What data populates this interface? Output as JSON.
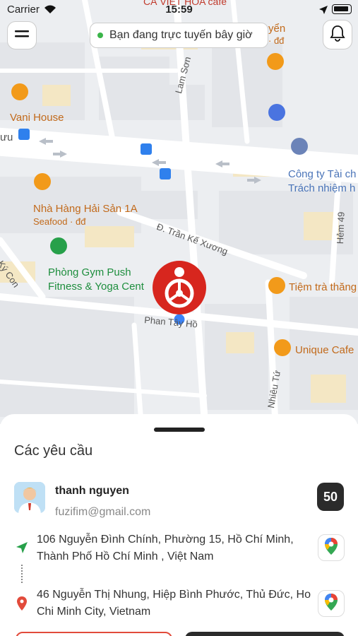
{
  "status_bar": {
    "carrier": "Carrier",
    "time": "15:59"
  },
  "header": {
    "online_status": "Bạn đang trực tuyến bây giờ"
  },
  "map": {
    "places": {
      "vani_house": "Vani House",
      "nha_hang": "Nhà Hàng Hải Sản 1A",
      "nha_hang_sub": "Seafood · đđ",
      "gym_line1": "Phòng Gym Push",
      "gym_line2": "Fitness & Yoga Cent",
      "tiem_tra": "Tiệm trà thăng",
      "unique_cafe": "Unique Cafe",
      "cong_ty_line1": "Công ty Tài ch",
      "cong_ty_line2": "Trách nhiệm h",
      "top_cafe": "CÀ VIỆT HÓA cafe",
      "top_right": "yển",
      "top_right_sub": "· đđ",
      "left_cut": "ưu"
    },
    "streets": {
      "lam_son": "Lam Sơn",
      "tran_ke_xuong": "Đ. Trần Kế Xương",
      "phan_ho": "Phan Tây Hồ",
      "hem_49": "Hẻm 49",
      "ky_con": "Ký Con",
      "nhieu_tu": "Nhiêu Tứ"
    }
  },
  "sheet": {
    "title": "Các yêu cầu",
    "request": {
      "user_name": "thanh nguyen",
      "email": "fuzifim@gmail.com",
      "count": "50",
      "pickup_address": "106 Nguyễn Đình Chính, Phường 15, Hồ Chí Minh, Thành Phố Hồ Chí Minh , Việt Nam",
      "dropoff_address": "46 Nguyễn Thị Nhung, Hiệp Bình Phước, Thủ Đức, Ho Chi Minh City, Vietnam"
    }
  },
  "colors": {
    "online": "#3bb54a",
    "marker": "#d7261e",
    "decline": "#e24b3b",
    "accept": "#2b2b2b"
  },
  "icons": [
    "menu-icon",
    "bell-icon",
    "location-arrow-icon",
    "map-pin-icon",
    "google-maps-icon",
    "car-marker-icon"
  ]
}
